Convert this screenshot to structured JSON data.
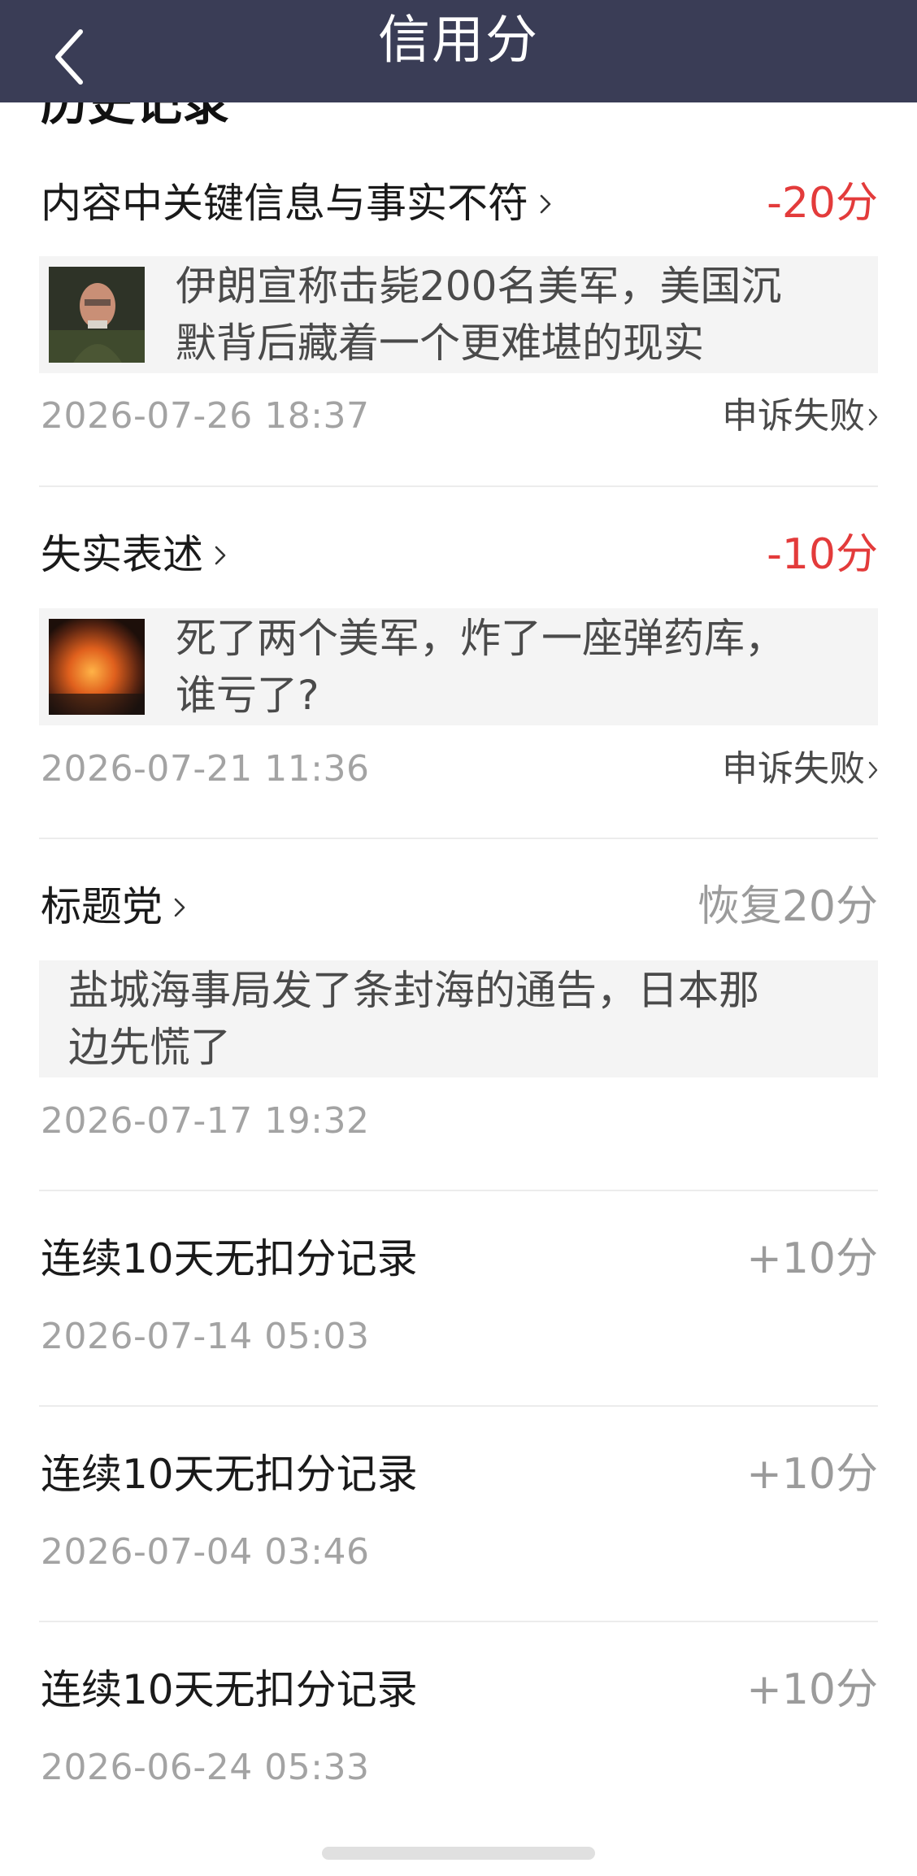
{
  "header": {
    "title": "信用分",
    "back_icon": "chevron-left-icon"
  },
  "section": {
    "heading": "历史记录"
  },
  "records": [
    {
      "title": "内容中关键信息与事实不符",
      "score": "-20分",
      "score_color": "#e33b3b",
      "article": "伊朗宣称击毙200名美军，美国沉默背后藏着一个更难堪的现实",
      "article_line1": "伊朗宣称击毙200名美军，美国沉",
      "article_line2": "默背后藏着一个更难堪的现实",
      "date": "2026-07-26 18:37",
      "appeal": "申诉失败"
    },
    {
      "title": "失实表述",
      "score": "-10分",
      "score_color": "#e33b3b",
      "article": "死了两个美军，炸了一座弹药库，谁亏了？",
      "article_line1": "死了两个美军，炸了一座弹药库，",
      "article_line2": "谁亏了?",
      "date": "2026-07-21 11:36",
      "appeal": "申诉失败"
    },
    {
      "title": "标题党",
      "score": "恢复20分",
      "score_color": "#9b9b9b",
      "article": "盐城海事局发了条封海的通告，日本那边先慌了",
      "article_line1": "盐城海事局发了条封海的通告，日本那",
      "article_line2": "边先慌了",
      "date": "2026-07-17 19:32"
    },
    {
      "title": "连续10天无扣分记录",
      "score": "+10分",
      "score_color": "#9b9b9b",
      "date": "2026-07-14 05:03"
    },
    {
      "title": "连续10天无扣分记录",
      "score": "+10分",
      "score_color": "#9b9b9b",
      "date": "2026-07-04 03:46"
    },
    {
      "title": "连续10天无扣分记录",
      "score": "+10分",
      "score_color": "#9b9b9b",
      "date": "2026-06-24 05:33"
    }
  ]
}
